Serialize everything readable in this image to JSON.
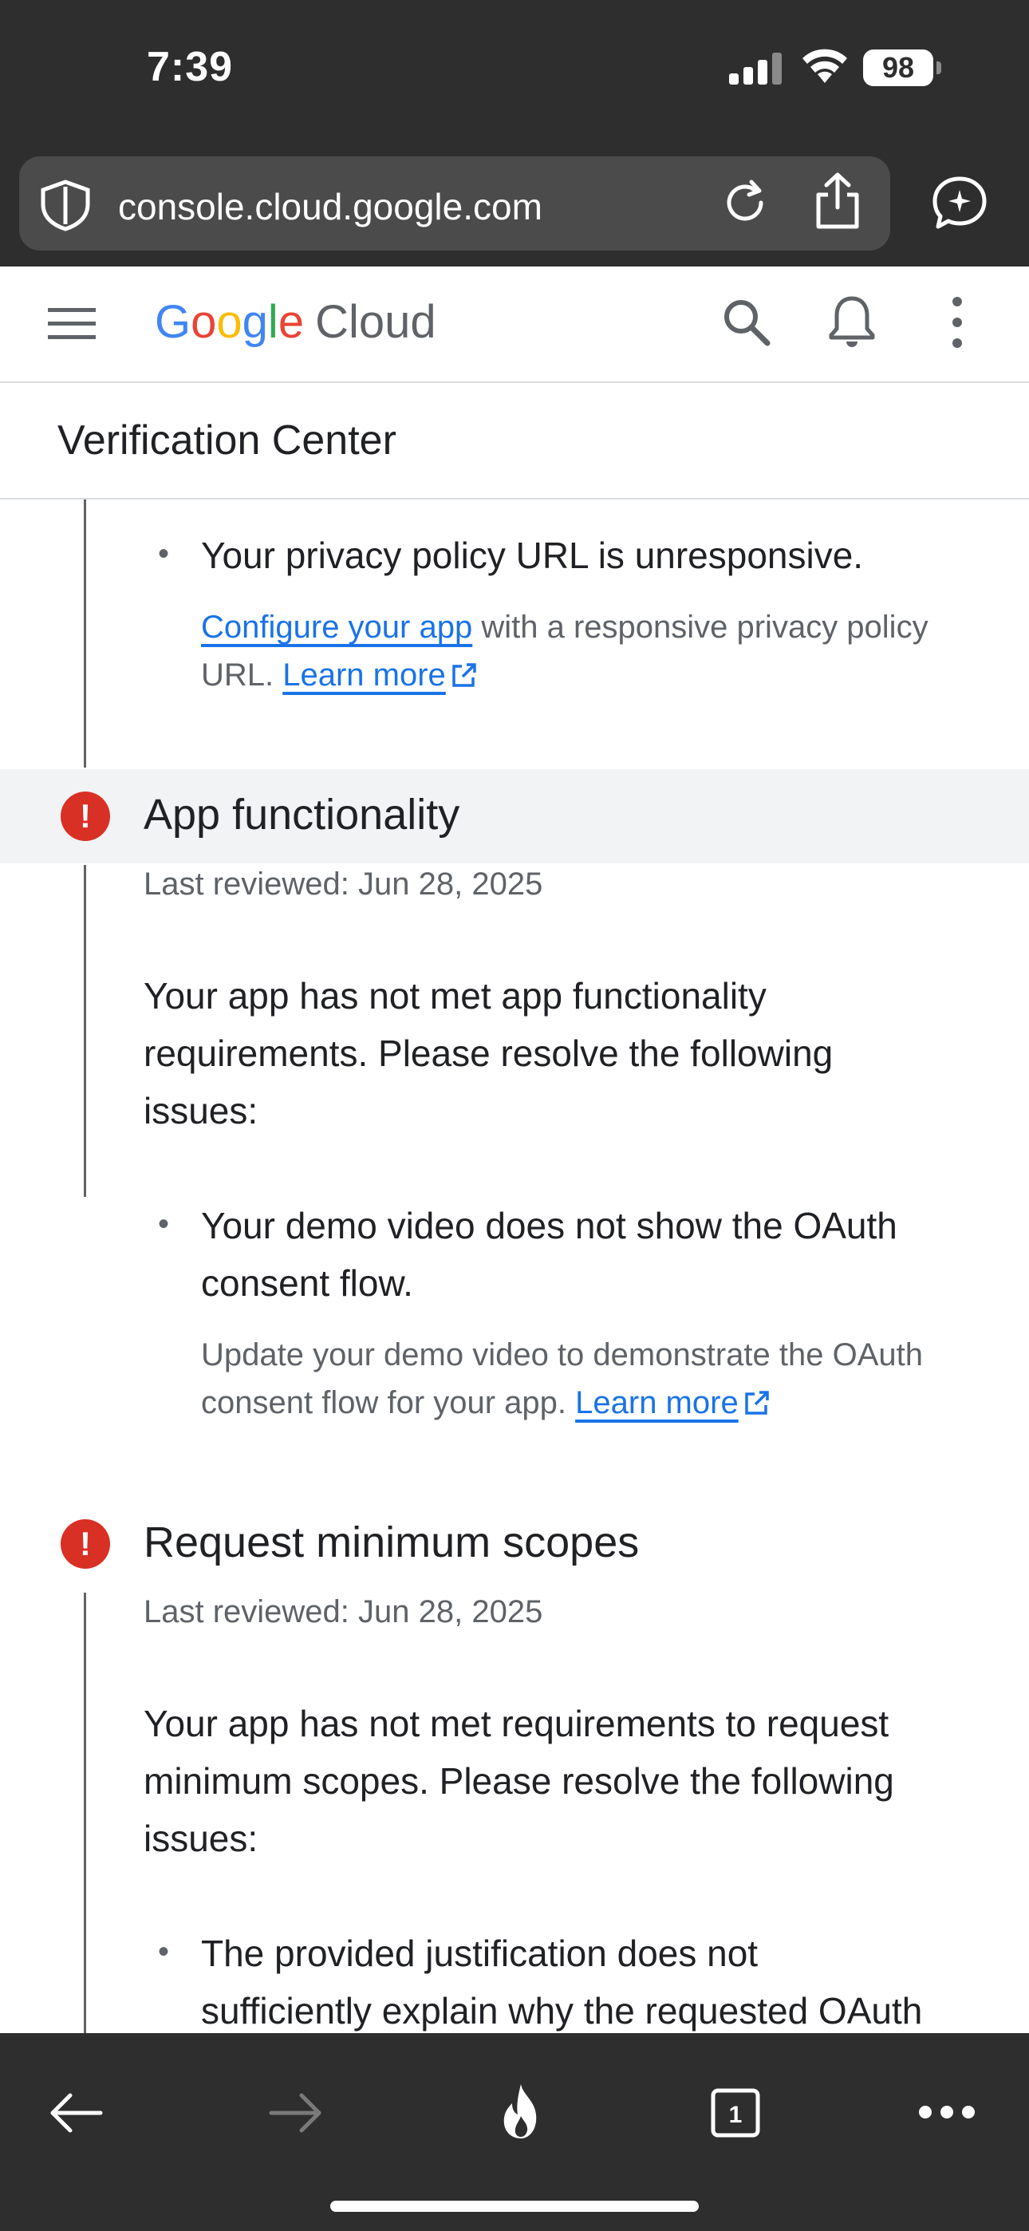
{
  "status_bar": {
    "time": "7:39",
    "battery": "98"
  },
  "browser": {
    "url": "console.cloud.google.com"
  },
  "header": {
    "logo_letters": [
      "G",
      "o",
      "o",
      "g",
      "l",
      "e"
    ],
    "logo_product": "Cloud",
    "icons": [
      "menu-icon",
      "search-icon",
      "bell-icon",
      "more-vert-icon"
    ]
  },
  "page": {
    "title": "Verification Center"
  },
  "privacy_issue": {
    "bullet": "Your privacy policy URL is unresponsive.",
    "link_configure": "Configure your app",
    "detail_line1_rest": " with a responsive privacy policy",
    "detail_line2_prefix": "URL. ",
    "learn_more": "Learn more"
  },
  "app_functionality": {
    "title": "App functionality",
    "reviewed": "Last reviewed: Jun 28, 2025",
    "para_lines": [
      "Your app has not met app functionality",
      "requirements. Please resolve the following",
      "issues:"
    ],
    "issue_lines": [
      "Your demo video does not show the OAuth",
      "consent flow."
    ],
    "detail_line1": "Update your demo video to demonstrate the OAuth",
    "detail_line2": "consent flow for your app. ",
    "learn_more": "Learn more"
  },
  "minimum_scopes": {
    "title": "Request minimum scopes",
    "reviewed": "Last reviewed: Jun 28, 2025",
    "para_lines": [
      "Your app has not met requirements to request",
      "minimum scopes. Please resolve the following",
      "issues:"
    ],
    "issue_lines": [
      "The provided justification does not",
      "sufficiently explain why the requested OAuth"
    ]
  },
  "bottom_toolbar": {
    "tab_count": "1"
  },
  "colors": {
    "chrome_bg": "#2e2e2e",
    "url_pill": "#4b4b4b",
    "link": "#1a73e8",
    "error": "#d93025",
    "section_highlight": "#f1f3f4",
    "muted_text": "#5f6368"
  }
}
